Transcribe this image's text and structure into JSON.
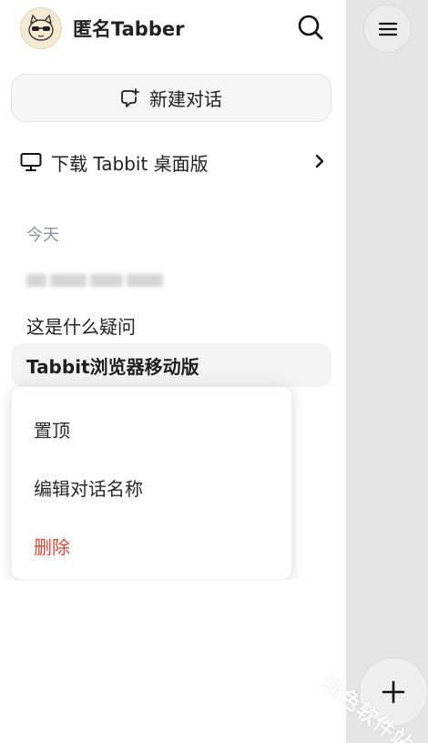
{
  "header": {
    "user_name": "匿名Tabber",
    "avatar_icon": "cat-sunglasses-avatar",
    "search_icon": "search-icon"
  },
  "new_chat": {
    "label": "新建对话",
    "icon": "chat-add-icon"
  },
  "download": {
    "label": "下载 Tabbit 桌面版",
    "icon": "monitor-icon"
  },
  "sections": [
    {
      "title": "今天",
      "items": [
        {
          "label": "",
          "blurred": true
        },
        {
          "label": "这是什么疑问"
        },
        {
          "label": "Tabbit浏览器移动版",
          "active": true
        }
      ]
    }
  ],
  "context_menu": {
    "items": [
      {
        "label": "置顶"
      },
      {
        "label": "编辑对话名称"
      },
      {
        "label": "删除",
        "danger": true
      }
    ]
  },
  "watermark": "绿色软件站",
  "colors": {
    "danger": "#d84a3a",
    "section_title": "#8d93a3",
    "panel_bg": "#e5e5e5"
  }
}
